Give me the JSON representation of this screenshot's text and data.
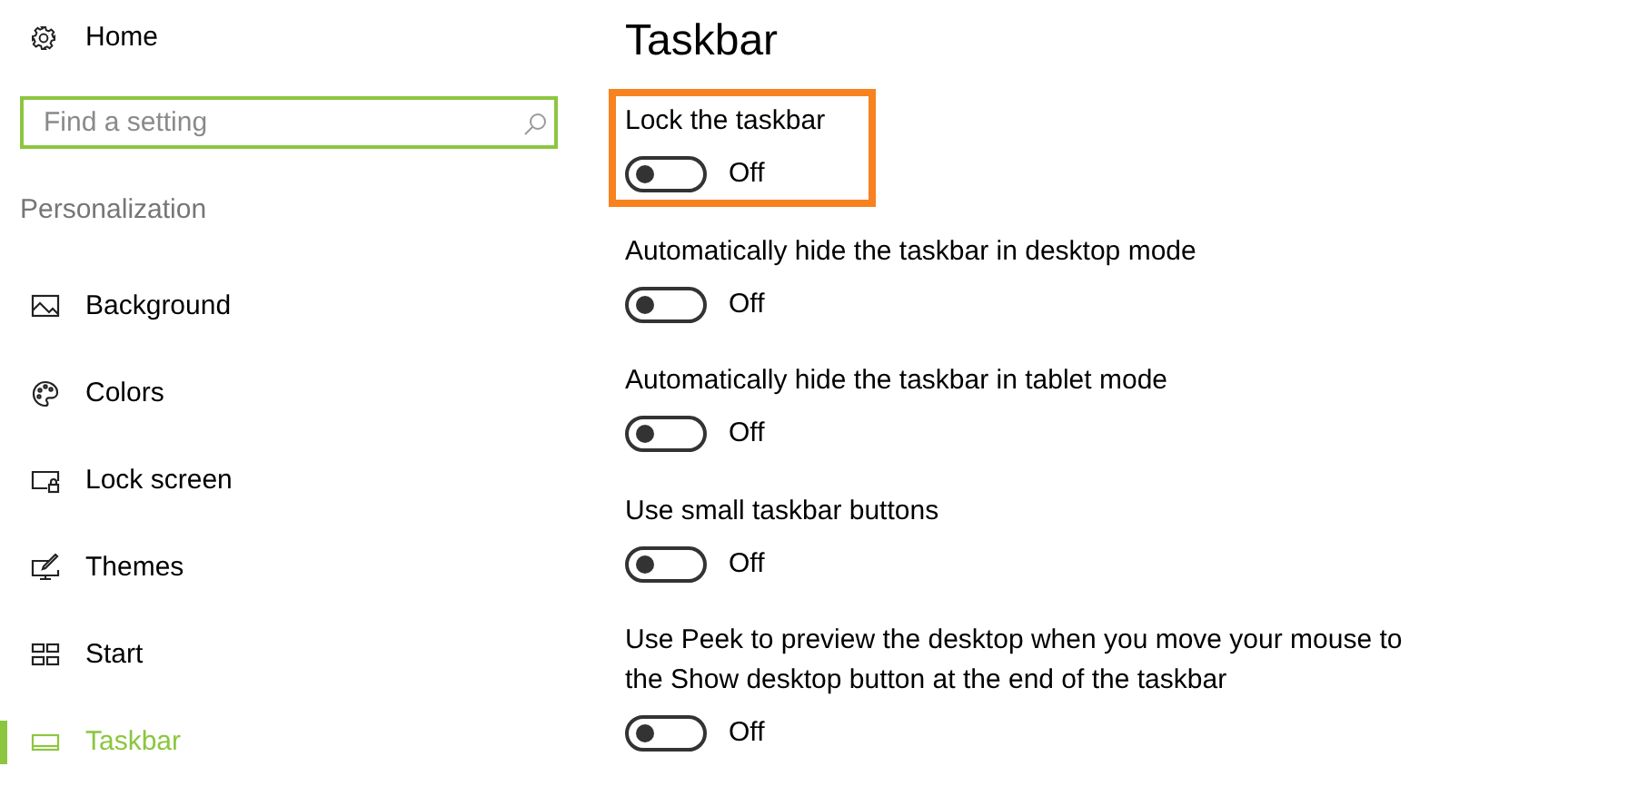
{
  "sidebar": {
    "home": {
      "label": "Home"
    },
    "search": {
      "placeholder": "Find a setting"
    },
    "section": "Personalization",
    "items": [
      {
        "label": "Background",
        "selected": false
      },
      {
        "label": "Colors",
        "selected": false
      },
      {
        "label": "Lock screen",
        "selected": false
      },
      {
        "label": "Themes",
        "selected": false
      },
      {
        "label": "Start",
        "selected": false
      },
      {
        "label": "Taskbar",
        "selected": true
      }
    ]
  },
  "page": {
    "title": "Taskbar",
    "settings": [
      {
        "label": "Lock the taskbar",
        "on": false,
        "state": "Off",
        "highlighted": true
      },
      {
        "label": "Automatically hide the taskbar in desktop mode",
        "on": false,
        "state": "Off",
        "highlighted": false
      },
      {
        "label": "Automatically hide the taskbar in tablet mode",
        "on": false,
        "state": "Off",
        "highlighted": false
      },
      {
        "label": "Use small taskbar buttons",
        "on": false,
        "state": "Off",
        "highlighted": false
      },
      {
        "label": "Use Peek to preview the desktop when you move your mouse to the Show desktop button at the end of the taskbar",
        "on": false,
        "state": "Off",
        "highlighted": false
      }
    ]
  }
}
